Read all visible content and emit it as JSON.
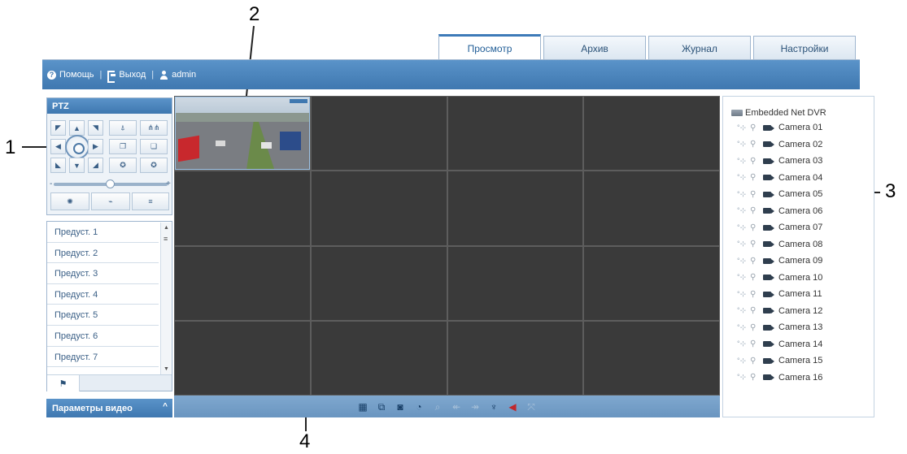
{
  "annotations": {
    "c1": "1",
    "c2": "2",
    "c3": "3",
    "c4": "4"
  },
  "tabs": [
    {
      "label": "Просмотр",
      "active": true
    },
    {
      "label": "Архив",
      "active": false
    },
    {
      "label": "Журнал",
      "active": false
    },
    {
      "label": "Настройки",
      "active": false
    }
  ],
  "topbar": {
    "help": "Помощь",
    "logout": "Выход",
    "user": "admin",
    "separator": "|"
  },
  "ptz": {
    "title": "PTZ",
    "slider_min_label": "-",
    "slider_max_label": "+",
    "speed_level": 0.5
  },
  "presets": {
    "items": [
      "Предуст. 1",
      "Предуст. 2",
      "Предуст. 3",
      "Предуст. 4",
      "Предуст. 5",
      "Предуст. 6",
      "Предуст. 7"
    ]
  },
  "video_params": {
    "label": "Параметры видео",
    "chevron": "^"
  },
  "grid": {
    "rows": 4,
    "cols": 4,
    "live_cell": 0
  },
  "toolbar": {
    "icons": [
      "layout-icon",
      "window-icon",
      "snapshot-icon",
      "record-icon",
      "zoom-icon",
      "prev-icon",
      "next-icon",
      "microphone-icon",
      "volume-icon",
      "fullscreen-icon"
    ]
  },
  "tree": {
    "root": "Embedded Net DVR",
    "cameras": [
      "Camera 01",
      "Camera 02",
      "Camera 03",
      "Camera 04",
      "Camera 05",
      "Camera 06",
      "Camera 07",
      "Camera 08",
      "Camera 09",
      "Camera 10",
      "Camera 11",
      "Camera 12",
      "Camera 13",
      "Camera 14",
      "Camera 15",
      "Camera 16"
    ]
  },
  "colors": {
    "accent": "#3f78b0",
    "grid_bg": "#3a3a3a",
    "tab_text": "#2b5278"
  }
}
